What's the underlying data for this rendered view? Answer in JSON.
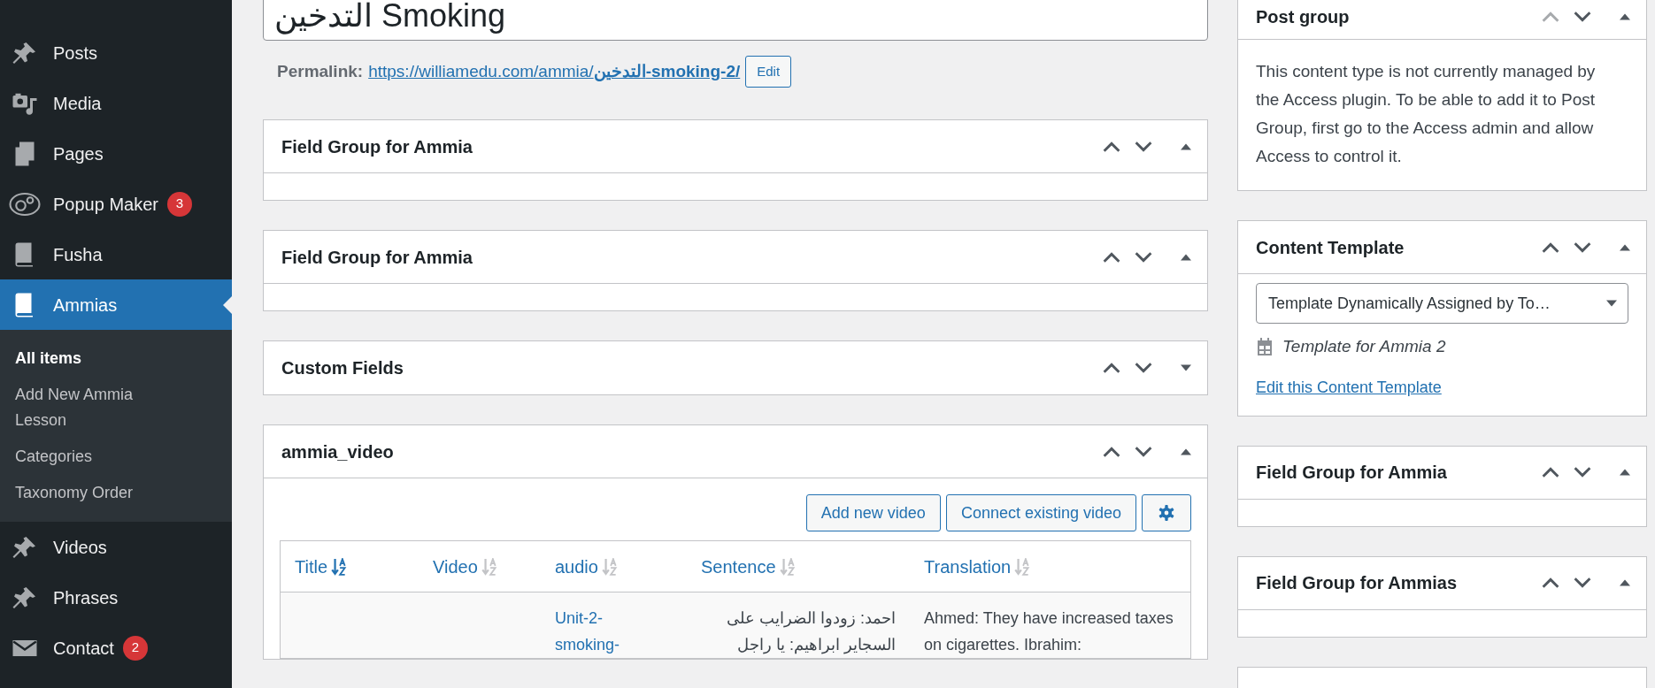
{
  "sidebar": {
    "items": [
      {
        "label": "Posts",
        "kind": "pin",
        "selected": false
      },
      {
        "label": "Media",
        "kind": "media",
        "selected": false
      },
      {
        "label": "Pages",
        "kind": "pages",
        "selected": false
      },
      {
        "label": "Popup Maker",
        "kind": "popup",
        "selected": false,
        "badge": "3"
      },
      {
        "label": "Fusha",
        "kind": "book",
        "selected": false
      },
      {
        "label": "Ammias",
        "kind": "book",
        "selected": true,
        "submenu": [
          {
            "label": "All items",
            "selected": true
          },
          {
            "label": "Add New Ammia Lesson",
            "selected": false
          },
          {
            "label": "Categories",
            "selected": false
          },
          {
            "label": "Taxonomy Order",
            "selected": false
          }
        ]
      },
      {
        "label": "Videos",
        "kind": "pin",
        "selected": false
      },
      {
        "label": "Phrases",
        "kind": "pin",
        "selected": false
      },
      {
        "label": "Contact",
        "kind": "mail",
        "selected": false,
        "badge": "2"
      }
    ]
  },
  "title_field": {
    "value": "التدخين Smoking"
  },
  "permalink": {
    "label": "Permalink:",
    "url_base": "https://williamedu.com/ammia/",
    "url_slug": "التدخين-smoking-2/",
    "edit_button": "Edit"
  },
  "main_boxes": [
    {
      "title": "Field Group for Ammia",
      "collapsed": false,
      "can_move_up": true
    },
    {
      "title": "Field Group for Ammia",
      "collapsed": false,
      "can_move_up": true
    },
    {
      "title": "Custom Fields",
      "collapsed": true,
      "can_move_up": true
    },
    {
      "title": "ammia_video",
      "collapsed": false,
      "can_move_up": true,
      "kind": "videos"
    }
  ],
  "video_box": {
    "buttons": [
      "Add new video",
      "Connect existing video"
    ],
    "table": {
      "columns": [
        {
          "label": "Title",
          "sorted": true
        },
        {
          "label": "Video",
          "sorted": false
        },
        {
          "label": "audio",
          "sorted": false
        },
        {
          "label": "Sentence",
          "sorted": false
        },
        {
          "label": "Translation",
          "sorted": false
        }
      ],
      "rows": [
        {
          "title": "",
          "video": "",
          "audio": "Unit-2-smoking-",
          "sentence": "احمد: زودوا الضرايب على السجاير ابراهيم: يا راجل",
          "translation": "Ahmed: They have increased taxes on cigarettes. Ibrahim:"
        }
      ]
    }
  },
  "side_boxes": [
    {
      "title": "Post group",
      "collapsed": false,
      "can_move_up": false,
      "kind": "text",
      "text": "This content type is not currently managed by the Access plugin. To be able to add it to Post Group, first go to the Access admin and allow Access to control it."
    },
    {
      "title": "Content Template",
      "collapsed": false,
      "can_move_up": true,
      "kind": "template",
      "select": "Template Dynamically Assigned by To…",
      "template_name": "Template for Ammia 2",
      "link": "Edit this Content Template"
    },
    {
      "title": "Field Group for Ammia",
      "collapsed": false,
      "can_move_up": true
    },
    {
      "title": "Field Group for Ammias",
      "collapsed": false,
      "can_move_up": true
    }
  ]
}
